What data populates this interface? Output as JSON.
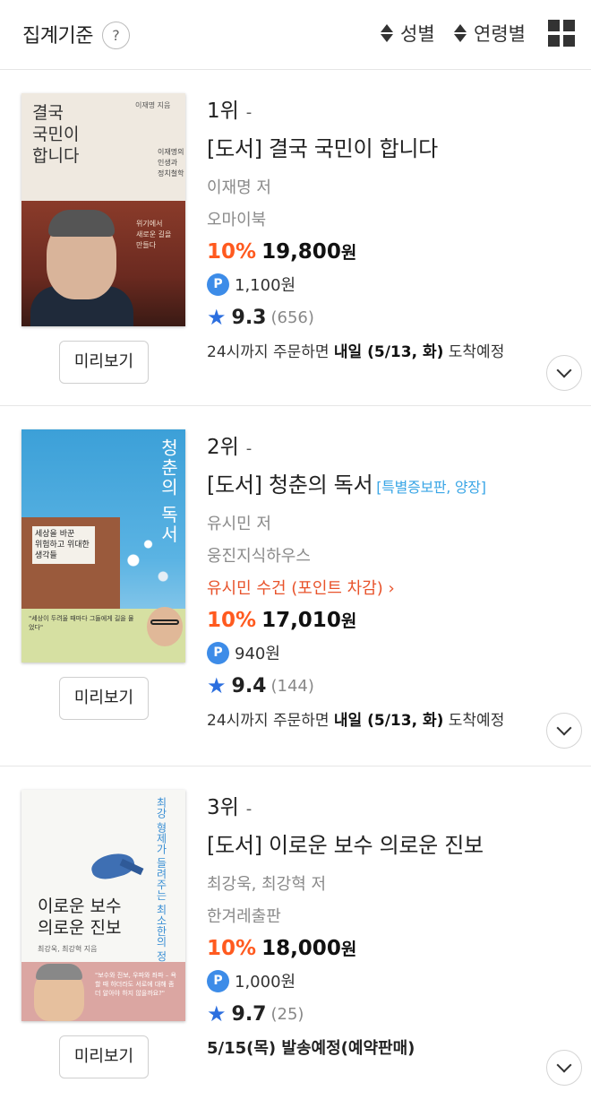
{
  "header": {
    "title": "집계기준",
    "help_label": "?",
    "sort_gender": "성별",
    "sort_age": "연령별",
    "view_icon": "grid-view-icon"
  },
  "books": [
    {
      "rank": "1위",
      "rank_change": "-",
      "title": "[도서] 결국 국민이 합니다",
      "tag": "",
      "author": "이재명 저",
      "publisher": "오마이북",
      "promo": "",
      "discount": "10%",
      "price": "19,800",
      "won": "원",
      "points": "1,100원",
      "rating": "9.3",
      "review_count": "(656)",
      "delivery_prefix": "24시까지 주문하면",
      "delivery_bold": "내일 (5/13, 화)",
      "delivery_suffix": "도착예정",
      "preview_label": "미리보기",
      "cover": {
        "title_lines": [
          "결국",
          "국민이",
          "합니다"
        ],
        "author_small": "이재명 지음",
        "sub_lines": [
          "이재명의",
          "인생과",
          "정치철학"
        ],
        "side_lines": [
          "위기에서",
          "새로운 길을",
          "만들다"
        ]
      }
    },
    {
      "rank": "2위",
      "rank_change": "-",
      "title": "[도서] 청춘의 독서",
      "tag": "[특별증보판, 양장]",
      "author": "유시민 저",
      "publisher": "웅진지식하우스",
      "promo": "유시민 수건 (포인트 차감) ›",
      "discount": "10%",
      "price": "17,010",
      "won": "원",
      "points": "940원",
      "rating": "9.4",
      "review_count": "(144)",
      "delivery_prefix": "24시까지 주문하면",
      "delivery_bold": "내일 (5/13, 화)",
      "delivery_suffix": "도착예정",
      "preview_label": "미리보기",
      "cover": {
        "vertical_title": "청춘의 독서",
        "label_lines": [
          "세상을 바꾼",
          "위험하고 위대한",
          "생각들"
        ],
        "band_text": "\"세상이 두려울 때마다 그들에게 길을 물었다\""
      }
    },
    {
      "rank": "3위",
      "rank_change": "-",
      "title": "[도서] 이로운 보수 의로운 진보",
      "tag": "",
      "author": "최강욱, 최강혁 저",
      "publisher": "한겨레출판",
      "promo": "",
      "discount": "10%",
      "price": "18,000",
      "won": "원",
      "points": "1,000원",
      "rating": "9.7",
      "review_count": "(25)",
      "shipping": "5/15(목) 발송예정(예약판매)",
      "preview_label": "미리보기",
      "cover": {
        "vertical_title": "최강 형제가 들려주는 최소한의 정치 교양",
        "title_lines": [
          "이로운 보수",
          "의로운 진보"
        ],
        "author_small": "최강욱, 최강혁 지음",
        "quote": "\"보수와 진보, 우파와 좌파 – 욕할 때 하더라도 서로에 대해 좀 더 알아야 하지 않을까요?\""
      }
    }
  ],
  "colors": {
    "discount": "#ff5a1f",
    "point_badge": "#3d8ce8",
    "star": "#2c6fdf",
    "tag": "#3aa6e6",
    "promo": "#e8532b"
  }
}
